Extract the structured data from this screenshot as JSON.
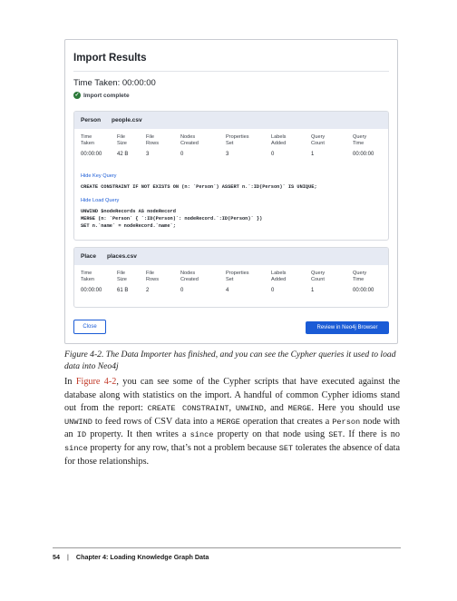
{
  "dialog": {
    "title": "Import Results",
    "time_taken": "Time Taken: 00:00:00",
    "status": "Import complete",
    "headers": [
      "Time\nTaken",
      "File\nSize",
      "File\nRows",
      "Nodes\nCreated",
      "Properties\nSet",
      "Labels\nAdded",
      "Query\nCount",
      "Query\nTime"
    ],
    "cards": [
      {
        "label": "Person",
        "file": "people.csv",
        "values": [
          "00:00:00",
          "42 B",
          "3",
          "0",
          "3",
          "0",
          "1",
          "00:00:00"
        ],
        "link1": "Hide Key Query",
        "key_query": "CREATE CONSTRAINT IF NOT EXISTS ON (n: `Person`) ASSERT n.`:ID(Person)` IS UNIQUE;",
        "link2": "Hide Load Query",
        "load_query": "UNWIND $nodeRecords AS nodeRecord\nMERGE (n: `Person` { `:ID(Person)`: nodeRecord.`:ID(Person)` })\nSET n.`name` = nodeRecord.`name`;"
      },
      {
        "label": "Place",
        "file": "places.csv",
        "values": [
          "00:00:00",
          "61 B",
          "2",
          "0",
          "4",
          "0",
          "1",
          "00:00:00"
        ]
      }
    ],
    "close_label": "Close",
    "review_label": "Review in Neo4j Browser"
  },
  "caption": "Figure 4-2. The Data Importer has finished, and you can see the Cypher queries it used to load data into Neo4j",
  "paragraph": {
    "p1": "In ",
    "ref": "Figure 4-2",
    "p2": ", you can see some of the Cypher scripts that have executed against the database along with statistics on the import. A handful of common Cypher idioms stand out from the report: ",
    "c1": "CREATE CONSTRAINT",
    "p3": ", ",
    "c2": "UNWIND",
    "p4": ", and ",
    "c3": "MERGE",
    "p5": ". Here you should use ",
    "c4": "UNWIND",
    "p6": " to feed rows of CSV data into a ",
    "c5": "MERGE",
    "p7": " operation that creates a ",
    "c6": "Person",
    "p8": " node with an ",
    "c7": "ID",
    "p9": " property. It then writes a ",
    "c8": "since",
    "p10": " property on that node using ",
    "c9": "SET",
    "p11": ". If there is no ",
    "c10": "since",
    "p12": " property for any row, that’s not a problem because ",
    "c11": "SET",
    "p13": " tolerates the absence of data for those relationships."
  },
  "footer": {
    "page_number": "54",
    "separator": "|",
    "chapter": "Chapter 4: Loading Knowledge Graph Data"
  }
}
